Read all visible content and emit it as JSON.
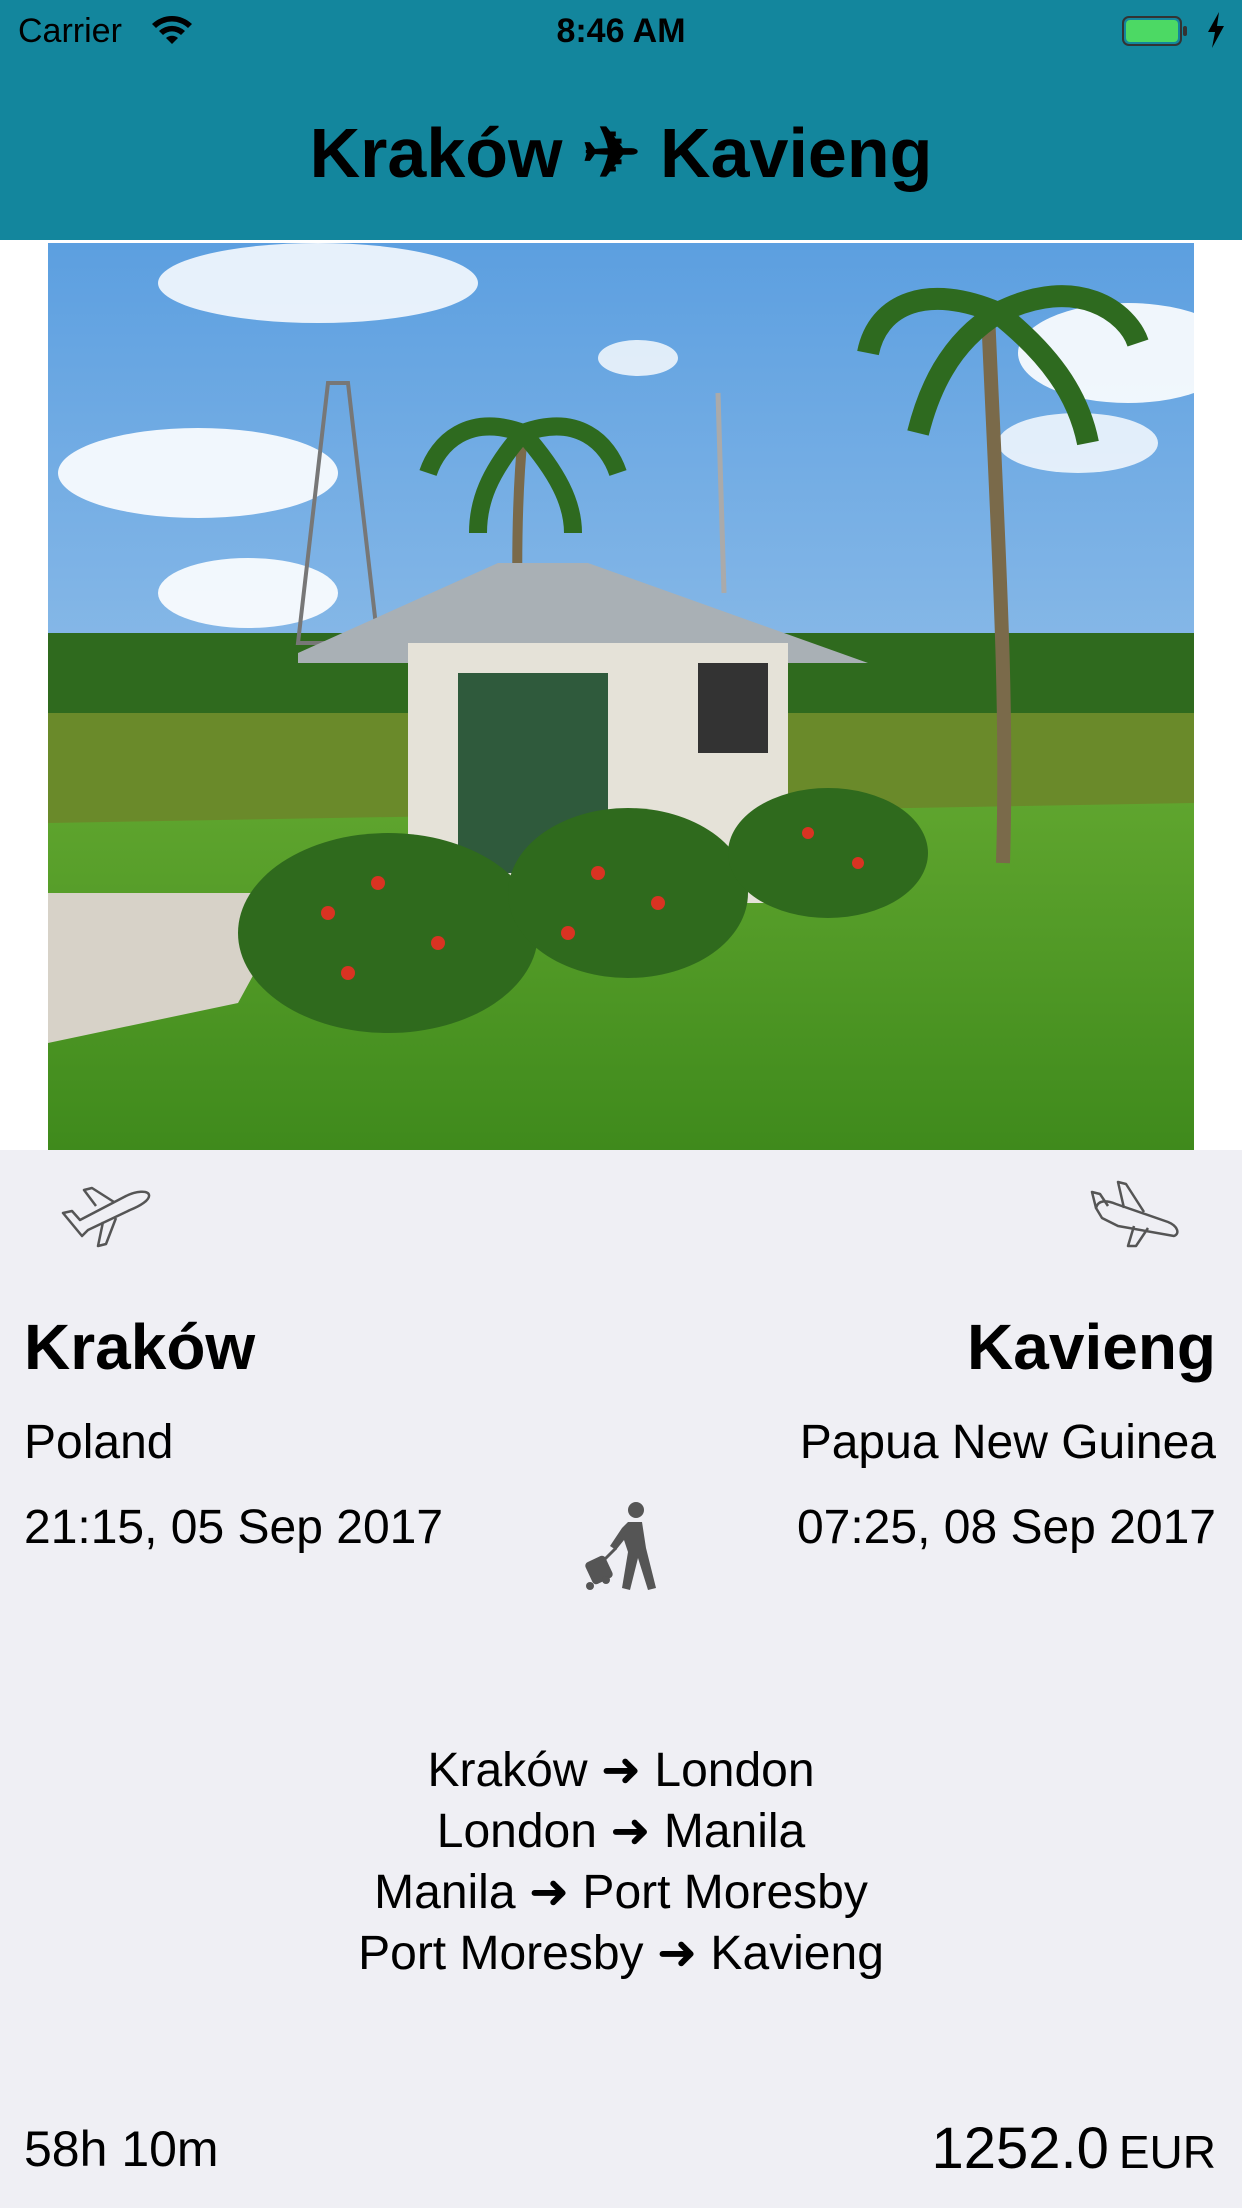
{
  "status_bar": {
    "carrier": "Carrier",
    "time": "8:46 AM"
  },
  "header": {
    "title": "Kraków ✈ Kavieng"
  },
  "flight": {
    "origin": {
      "city": "Kraków",
      "country": "Poland",
      "datetime": "21:15, 05 Sep 2017"
    },
    "destination": {
      "city": "Kavieng",
      "country": "Papua New Guinea",
      "datetime": "07:25, 08 Sep 2017"
    },
    "legs": [
      "Kraków ➜ London",
      "London ➜ Manila",
      "Manila ➜ Port Moresby",
      "Port Moresby ➜ Kavieng"
    ],
    "duration": "58h 10m",
    "price": "1252.0",
    "currency": "EUR"
  },
  "colors": {
    "header": "#13869d",
    "background": "#efeff4",
    "battery": "#4cd964"
  },
  "icons": [
    "wifi-icon",
    "battery-icon",
    "charging-bolt-icon",
    "departure-plane-icon",
    "arrival-plane-icon",
    "traveler-icon"
  ]
}
